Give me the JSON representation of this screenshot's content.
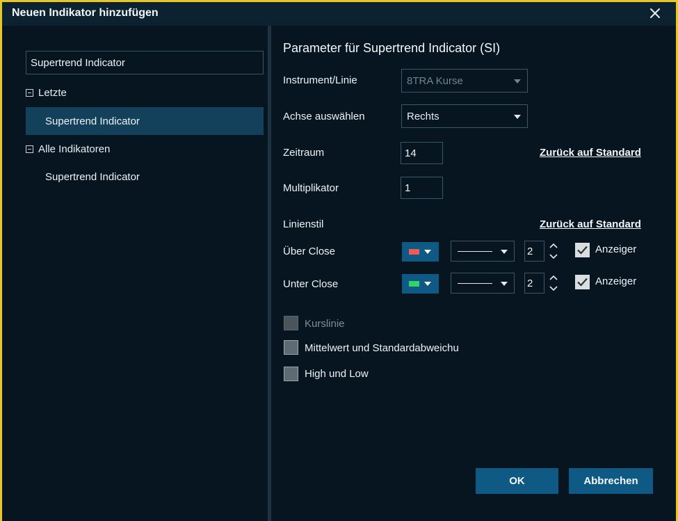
{
  "window": {
    "title": "Neuen Indikator hinzufügen"
  },
  "sidebar": {
    "search_value": "Supertrend Indicator",
    "groups": [
      {
        "label": "Letzte",
        "items": [
          {
            "label": "Supertrend Indicator",
            "selected": true
          }
        ]
      },
      {
        "label": "Alle Indikatoren",
        "items": [
          {
            "label": "Supertrend Indicator",
            "selected": false
          }
        ]
      }
    ]
  },
  "params": {
    "title": "Parameter für Supertrend Indicator (SI)",
    "instrument": {
      "label": "Instrument/Linie",
      "value": "8TRA Kurse"
    },
    "axis": {
      "label": "Achse auswählen",
      "value": "Rechts"
    },
    "period": {
      "label": "Zeitraum",
      "value": "14"
    },
    "multiplier": {
      "label": "Multiplikator",
      "value": "1"
    },
    "reset_label": "Zurück auf Standard",
    "line_style_label": "Linienstil",
    "line_style_reset_label": "Zurück auf Standard",
    "above_close": {
      "label": "Über Close",
      "color": "#f15a5a",
      "width": "2",
      "show_label": "Anzeiger"
    },
    "below_close": {
      "label": "Unter Close",
      "color": "#35d26a",
      "width": "2",
      "show_label": "Anzeiger"
    },
    "options": [
      {
        "label": "Kurslinie",
        "checked": false,
        "disabled": true
      },
      {
        "label": "Mittelwert und Standardabweichu",
        "checked": false,
        "disabled": false
      },
      {
        "label": "High und Low",
        "checked": false,
        "disabled": false
      }
    ]
  },
  "footer": {
    "ok_label": "OK",
    "cancel_label": "Abbrechen"
  },
  "colors": {
    "accent": "#0f5a85",
    "selection": "#13405a",
    "frame": "#e8c820",
    "background": "#061520"
  },
  "icons": {
    "close": "close-icon",
    "collapse": "minus-square-icon",
    "dropdown": "chevron-down-icon",
    "spin_up": "chevron-up-icon",
    "spin_down": "chevron-down-icon",
    "check": "check-icon"
  }
}
